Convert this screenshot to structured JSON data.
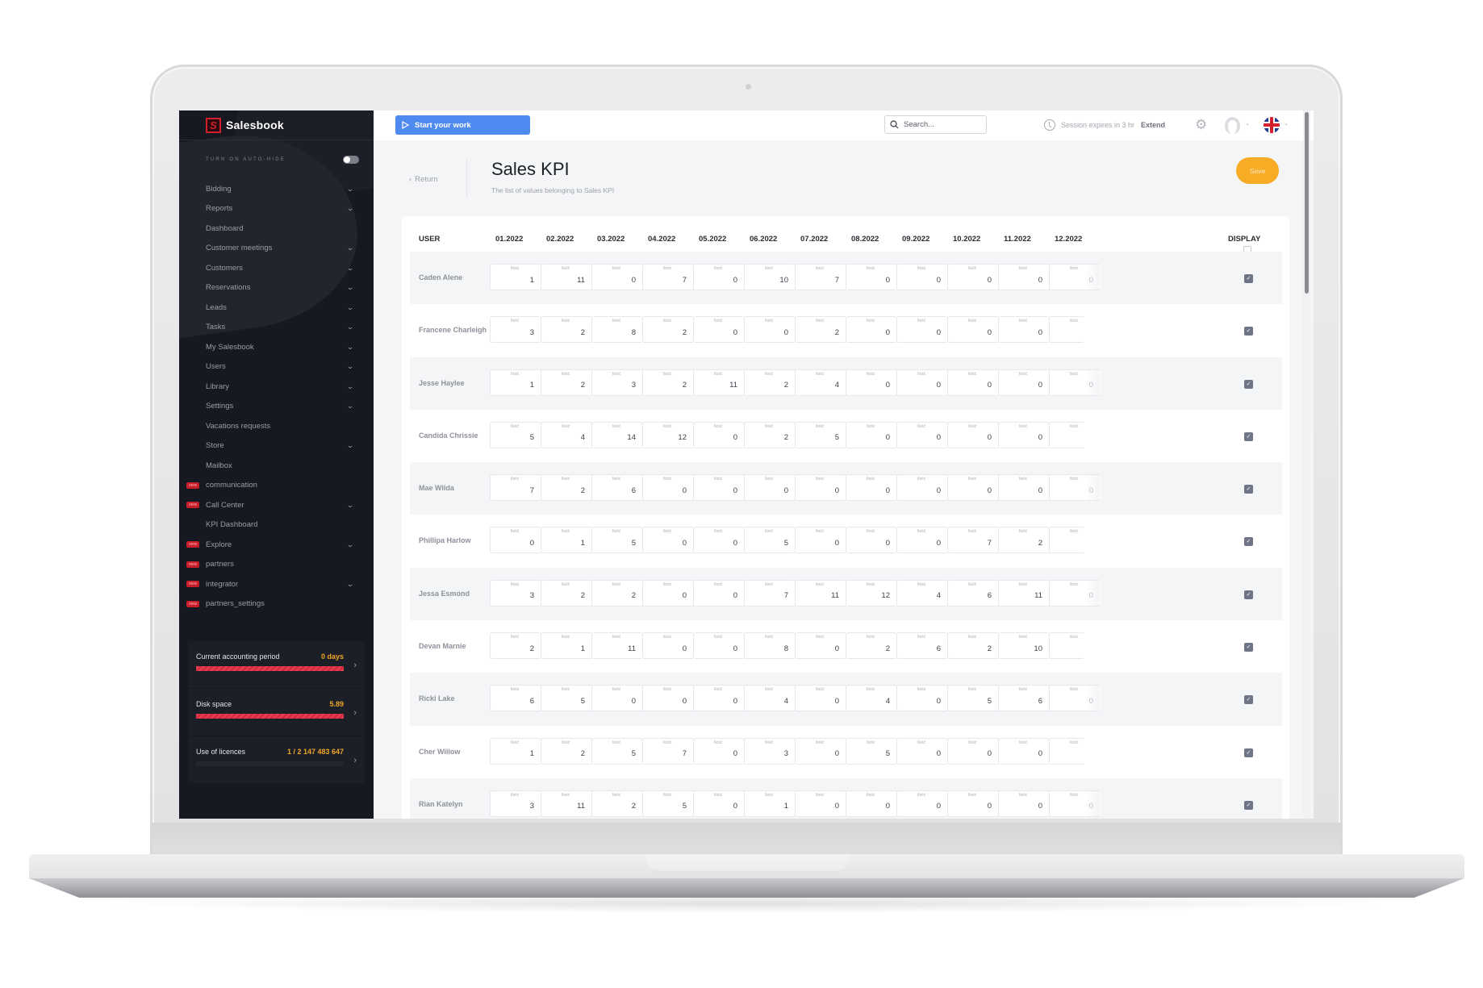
{
  "app": {
    "brand": "Salesbook",
    "logo_letter": "S"
  },
  "sidebar": {
    "autohide_label": "TURN ON AUTO-HIDE",
    "autohide_on": false,
    "items": [
      {
        "label": "Bidding",
        "chevron": true,
        "badge": null
      },
      {
        "label": "Reports",
        "chevron": true,
        "badge": null
      },
      {
        "label": "Dashboard",
        "chevron": false,
        "badge": null
      },
      {
        "label": "Customer meetings",
        "chevron": true,
        "badge": null
      },
      {
        "label": "Customers",
        "chevron": true,
        "badge": null
      },
      {
        "label": "Reservations",
        "chevron": true,
        "badge": null
      },
      {
        "label": "Leads",
        "chevron": true,
        "badge": null
      },
      {
        "label": "Tasks",
        "chevron": true,
        "badge": null
      },
      {
        "label": "My Salesbook",
        "chevron": true,
        "badge": null
      },
      {
        "label": "Users",
        "chevron": true,
        "badge": null
      },
      {
        "label": "Library",
        "chevron": true,
        "badge": null
      },
      {
        "label": "Settings",
        "chevron": true,
        "badge": null
      },
      {
        "label": "Vacations requests",
        "chevron": false,
        "badge": null
      },
      {
        "label": "Store",
        "chevron": true,
        "badge": null
      },
      {
        "label": "Mailbox",
        "chevron": false,
        "badge": null
      },
      {
        "label": "communication",
        "chevron": false,
        "badge": "new"
      },
      {
        "label": "Call Center",
        "chevron": true,
        "badge": "new"
      },
      {
        "label": "KPI Dashboard",
        "chevron": false,
        "badge": null
      },
      {
        "label": "Explore",
        "chevron": true,
        "badge": "new"
      },
      {
        "label": "partners",
        "chevron": false,
        "badge": "new"
      },
      {
        "label": "integrator",
        "chevron": true,
        "badge": "new"
      },
      {
        "label": "partners_settings",
        "chevron": false,
        "badge": "new"
      }
    ],
    "widgets": [
      {
        "label": "Current accounting period",
        "value": "0 days",
        "fill_percent": 100
      },
      {
        "label": "Disk space",
        "value": "5.89",
        "fill_percent": 100
      },
      {
        "label": "Use of licences",
        "value": "1 / 2 147 483 647",
        "fill_percent": 0
      }
    ]
  },
  "topbar": {
    "start_label": "Start your work",
    "search_placeholder": "Search...",
    "session_text": "Session expires in 3 hr",
    "extend_label": "Extend",
    "language": "English (UK)"
  },
  "page": {
    "return_label": "Return",
    "title": "Sales KPI",
    "subtitle": "The list of values belonging to Sales KPI",
    "save_label": "Save"
  },
  "colors": {
    "accent_blue": "#4e8af0",
    "save_orange": "#f8ab25",
    "brand_red": "#d21f2b",
    "sidebar_bg": "#171922",
    "widget_value": "#f0a623"
  },
  "table": {
    "user_header": "USER",
    "display_header": "DISPLAY",
    "cell_label": "Ilość",
    "months": [
      "01.2022",
      "02.2022",
      "03.2022",
      "04.2022",
      "05.2022",
      "06.2022",
      "07.2022",
      "08.2022",
      "09.2022",
      "10.2022",
      "11.2022",
      "12.2022"
    ],
    "rows": [
      {
        "user": "Caden Alene",
        "values": [
          "1",
          "11",
          "0",
          "7",
          "0",
          "10",
          "7",
          "0",
          "0",
          "0",
          "0",
          "0"
        ],
        "display": true
      },
      {
        "user": "Francene Charleigh",
        "values": [
          "3",
          "2",
          "8",
          "2",
          "0",
          "0",
          "2",
          "0",
          "0",
          "0",
          "0",
          ""
        ],
        "display": true
      },
      {
        "user": "Jesse Haylee",
        "values": [
          "1",
          "2",
          "3",
          "2",
          "11",
          "2",
          "4",
          "0",
          "0",
          "0",
          "0",
          "0"
        ],
        "display": true
      },
      {
        "user": "Candida Chrissie",
        "values": [
          "5",
          "4",
          "14",
          "12",
          "0",
          "2",
          "5",
          "0",
          "0",
          "0",
          "0",
          ""
        ],
        "display": true
      },
      {
        "user": "Mae Wilda",
        "values": [
          "7",
          "2",
          "6",
          "0",
          "0",
          "0",
          "0",
          "0",
          "0",
          "0",
          "0",
          "0"
        ],
        "display": true
      },
      {
        "user": "Phillipa Harlow",
        "values": [
          "0",
          "1",
          "5",
          "0",
          "0",
          "5",
          "0",
          "0",
          "0",
          "7",
          "2",
          ""
        ],
        "display": true
      },
      {
        "user": "Jessa Esmond",
        "values": [
          "3",
          "2",
          "2",
          "0",
          "0",
          "7",
          "11",
          "12",
          "4",
          "6",
          "11",
          "0"
        ],
        "display": true
      },
      {
        "user": "Devan Marnie",
        "values": [
          "2",
          "1",
          "11",
          "0",
          "0",
          "8",
          "0",
          "2",
          "6",
          "2",
          "10",
          ""
        ],
        "display": true
      },
      {
        "user": "Ricki Lake",
        "values": [
          "6",
          "5",
          "0",
          "0",
          "0",
          "4",
          "0",
          "4",
          "0",
          "5",
          "6",
          "0"
        ],
        "display": true
      },
      {
        "user": "Cher Willow",
        "values": [
          "1",
          "2",
          "5",
          "7",
          "0",
          "3",
          "0",
          "5",
          "0",
          "0",
          "0",
          ""
        ],
        "display": true
      },
      {
        "user": "Rian Katelyn",
        "values": [
          "3",
          "11",
          "2",
          "5",
          "0",
          "1",
          "0",
          "0",
          "0",
          "0",
          "0",
          "0"
        ],
        "display": true
      }
    ]
  }
}
